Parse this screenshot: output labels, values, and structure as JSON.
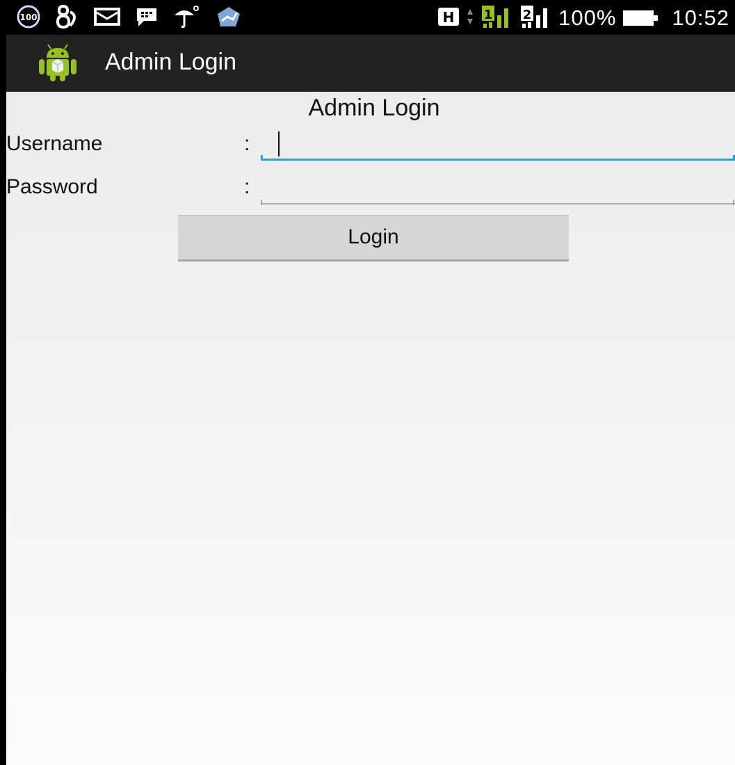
{
  "status_bar": {
    "notification_badge": "100",
    "network_type": "H",
    "sim1_label": "1",
    "sim2_label": "2",
    "battery_percent": "100%",
    "time": "10:52",
    "icons": [
      "badge-100-icon",
      "bbm-icon",
      "mail-icon",
      "chat-icon",
      "umbrella-weather-icon",
      "market-bag-icon",
      "h-network-icon",
      "data-arrows-icon",
      "signal-sim1-icon",
      "signal-sim2-icon",
      "battery-icon"
    ]
  },
  "action_bar": {
    "title": "Admin Login",
    "icon": "android-app-icon"
  },
  "form": {
    "heading": "Admin Login",
    "username_label": "Username",
    "password_label": "Password",
    "separator": ":",
    "username_value": "",
    "password_value": "",
    "login_label": "Login"
  },
  "colors": {
    "accent": "#2f9fcf",
    "action_bar": "#222222",
    "android_green": "#97c024"
  }
}
